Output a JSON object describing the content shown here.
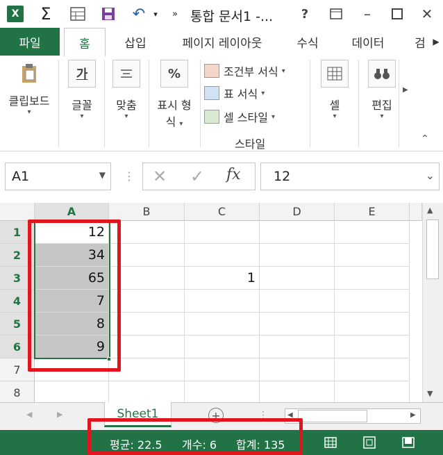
{
  "title": "통합 문서1 -...",
  "tabs": [
    "파일",
    "홈",
    "삽입",
    "페이지 레이아웃",
    "수식",
    "데이터",
    "검"
  ],
  "ribbon": {
    "clipboard": "클립보드",
    "font": "글꼴",
    "font_glyph": "가",
    "align": "맞춤",
    "number_line1": "표시 형",
    "number_line2": "식",
    "number_glyph": "%",
    "cond_format": "조건부 서식",
    "table_format": "표 서식",
    "cell_style": "셀 스타일",
    "style_group": "스타일",
    "cells": "셀",
    "edit": "편집"
  },
  "formula": {
    "name_box": "A1",
    "value": "12",
    "fx": "fx"
  },
  "columns": [
    "A",
    "B",
    "C",
    "D",
    "E"
  ],
  "rows": [
    "1",
    "2",
    "3",
    "4",
    "5",
    "6",
    "7",
    "8"
  ],
  "cells": {
    "A1": "12",
    "A2": "34",
    "A3": "65",
    "A4": "7",
    "A5": "8",
    "A6": "9",
    "C3": "1"
  },
  "sheet": "Sheet1",
  "status": {
    "average": "평균: 22.5",
    "count": "개수: 6",
    "sum": "합계: 135"
  },
  "colors": {
    "accent": "#217346",
    "highlight": "#e0161f"
  }
}
